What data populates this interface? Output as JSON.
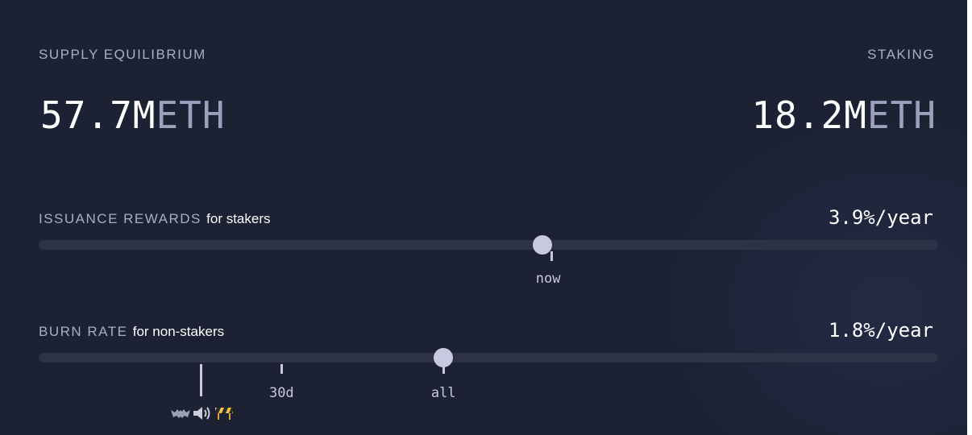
{
  "supply": {
    "label": "SUPPLY EQUILIBRIUM",
    "value": "57.7M",
    "unit": "ETH"
  },
  "staking": {
    "label": "STAKING",
    "value": "18.2M",
    "unit": "ETH"
  },
  "issuance": {
    "label": "ISSUANCE REWARDS",
    "hint": "for stakers",
    "rate": "3.9%/year",
    "slider_position": 0.56,
    "marks": [
      {
        "label": "now",
        "position": 0.57
      }
    ]
  },
  "burn": {
    "label": "BURN RATE",
    "hint": "for non-stakers",
    "rate": "1.8%/year",
    "slider_position": 0.45,
    "marks": [
      {
        "label": "",
        "position": 0.18
      },
      {
        "label": "30d",
        "position": 0.27
      },
      {
        "label": "all",
        "position": 0.45
      }
    ],
    "icons": [
      "bat-icon",
      "speaker-icon",
      "construction-icon"
    ]
  },
  "colors": {
    "background": "#1c2133",
    "track": "#2d3246",
    "thumb": "#c7c9e1",
    "label": "#a9aec4",
    "unit": "#9ba1bd"
  }
}
